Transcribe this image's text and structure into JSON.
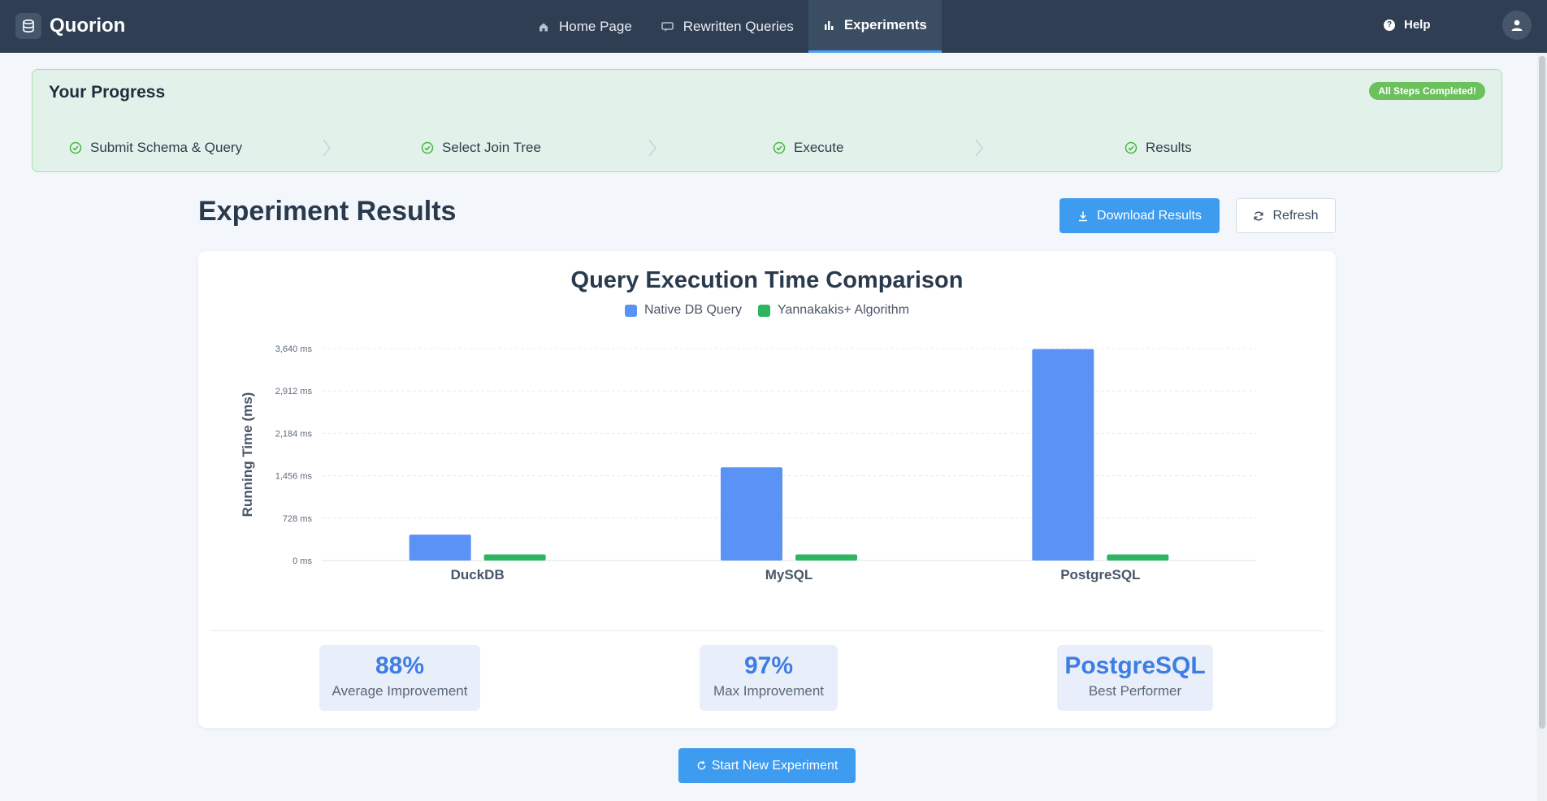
{
  "app": {
    "name": "Quorion"
  },
  "nav": {
    "items": [
      {
        "label": "Home Page",
        "icon": "home-icon"
      },
      {
        "label": "Rewritten Queries",
        "icon": "queries-icon"
      },
      {
        "label": "Experiments",
        "icon": "bar-chart-icon",
        "active": true
      }
    ],
    "help_label": "Help"
  },
  "progress": {
    "title": "Your Progress",
    "badge": "All Steps Completed!",
    "steps": [
      {
        "label": "Submit Schema & Query",
        "done": true
      },
      {
        "label": "Select Join Tree",
        "done": true
      },
      {
        "label": "Execute",
        "done": true
      },
      {
        "label": "Results",
        "done": true
      }
    ]
  },
  "page": {
    "title": "Experiment Results",
    "download_label": "Download Results",
    "refresh_label": "Refresh",
    "new_experiment_label": "Start New Experiment"
  },
  "chart_data": {
    "type": "bar",
    "title": "Query Execution Time Comparison",
    "ylabel": "Running Time (ms)",
    "xlabel": "",
    "categories": [
      "DuckDB",
      "MySQL",
      "PostgreSQL"
    ],
    "series": [
      {
        "name": "Native DB Query",
        "values": [
          445,
          1600,
          3630
        ],
        "color": "#5a93f5"
      },
      {
        "name": "Yannakakis+ Algorithm",
        "values": [
          105,
          105,
          105
        ],
        "color": "#2fb562"
      }
    ],
    "ylim": [
      0,
      3640
    ],
    "yticks": [
      {
        "value": 0,
        "label": "0 ms"
      },
      {
        "value": 728,
        "label": "728 ms"
      },
      {
        "value": 1456,
        "label": "1,456 ms"
      },
      {
        "value": 2184,
        "label": "2,184 ms"
      },
      {
        "value": 2912,
        "label": "2,912 ms"
      },
      {
        "value": 3640,
        "label": "3,640 ms"
      }
    ],
    "legend": "top-center",
    "grid": true
  },
  "stats": [
    {
      "value": "88%",
      "label": "Average Improvement"
    },
    {
      "value": "97%",
      "label": "Max Improvement"
    },
    {
      "value": "PostgreSQL",
      "label": "Best Performer"
    }
  ]
}
